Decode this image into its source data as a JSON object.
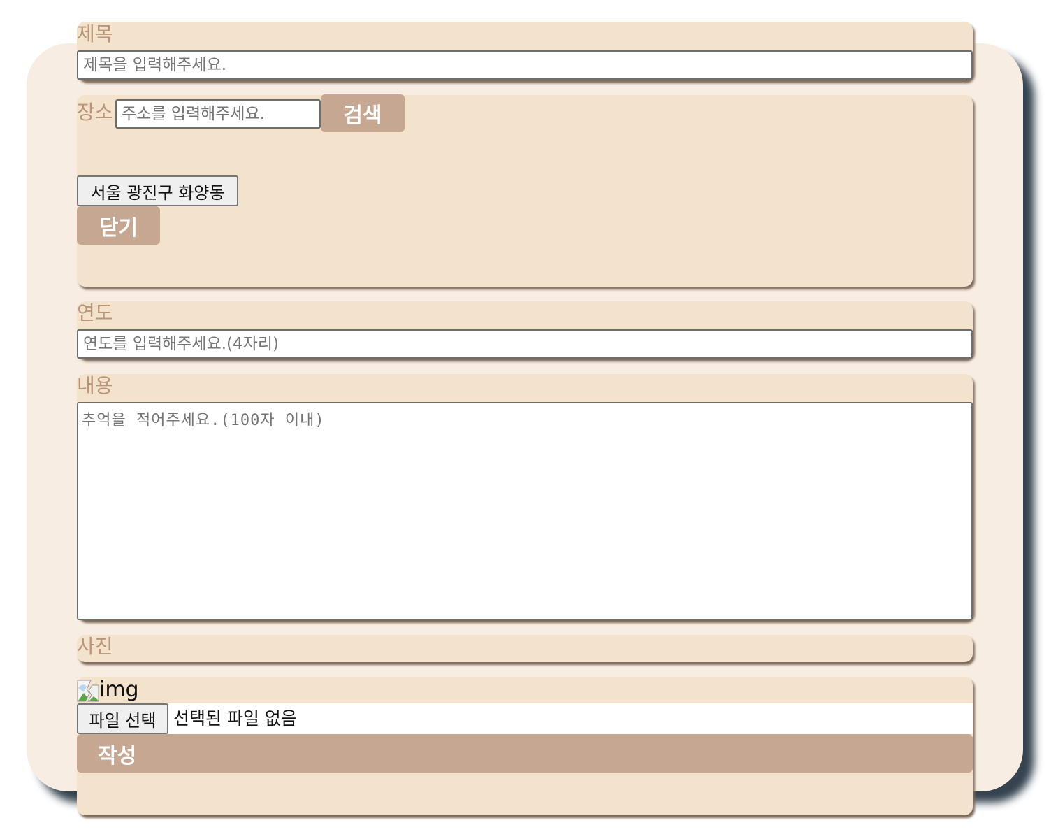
{
  "title_section": {
    "label": "제목",
    "placeholder": "제목을 입력해주세요."
  },
  "location_section": {
    "label": "장소",
    "placeholder": "주소를 입력해주세요.",
    "search_label": "검색",
    "result_label": "서울 광진구 화양동",
    "close_label": "닫기"
  },
  "year_section": {
    "label": "연도",
    "placeholder": "연도를 입력해주세요.(4자리)"
  },
  "content_section": {
    "label": "내용",
    "placeholder": "추억을 적어주세요.(100자 이내)"
  },
  "photo_section": {
    "label": "사진",
    "image_alt": "img",
    "file_button_label": "파일 선택",
    "file_status": "선택된 파일 없음"
  },
  "submit_label": "작성",
  "colors": {
    "card_background": "#f7ede2",
    "section_background": "#f4e3cc",
    "label_color": "#b99579",
    "button_color": "#c6a892",
    "shadow_color": "#354350"
  },
  "icons": {
    "broken_image": "broken-image-icon"
  }
}
